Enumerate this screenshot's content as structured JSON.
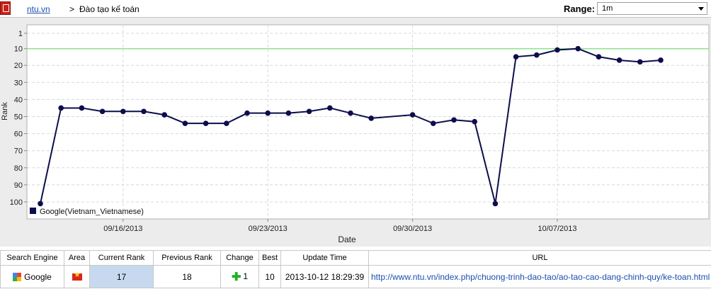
{
  "toolbar": {
    "domain": "ntu.vn",
    "separator": ">",
    "keyword": "Đào tạo kế toán",
    "range_label": "Range:",
    "range_value": "1m"
  },
  "chart_data": {
    "type": "line",
    "xlabel": "Date",
    "ylabel": "Rank",
    "ylim": [
      1,
      104
    ],
    "y_inverted": true,
    "yticks": [
      1,
      10,
      20,
      30,
      40,
      50,
      60,
      70,
      80,
      90,
      100
    ],
    "xticks": [
      "09/16/2013",
      "09/23/2013",
      "09/30/2013",
      "10/07/2013"
    ],
    "x_tick_day_index": [
      4,
      11,
      18,
      25
    ],
    "grid": true,
    "legend_position": "bottom-left",
    "reference_line_rank": 10,
    "colors": {
      "series": "#0d0d4d",
      "reference": "#90e090",
      "background": "#ffffff",
      "grid": "#d8d8d8"
    },
    "series": [
      {
        "name": "Google(Vietnam_Vietnamese)",
        "x": [
          0,
          1,
          2,
          3,
          4,
          5,
          6,
          7,
          8,
          9,
          10,
          11,
          12,
          13,
          14,
          15,
          16,
          18,
          19,
          20,
          21,
          22,
          23,
          24,
          25,
          26,
          27,
          28,
          29,
          30
        ],
        "values": [
          101,
          45,
          45,
          47,
          47,
          47,
          49,
          54,
          54,
          54,
          48,
          48,
          48,
          47,
          45,
          48,
          51,
          49,
          54,
          52,
          53,
          101,
          15,
          14,
          11,
          10,
          15,
          17,
          18,
          17
        ]
      }
    ]
  },
  "table": {
    "headers": [
      "Search Engine",
      "Area",
      "Current Rank",
      "Previous Rank",
      "Change",
      "Best",
      "Update Time",
      "URL"
    ],
    "row": {
      "engine": "Google",
      "current_rank": "17",
      "previous_rank": "18",
      "change": "1",
      "best": "10",
      "update_time": "2013-10-12 18:29:39",
      "url": "http://www.ntu.vn/index.php/chuong-trinh-dao-tao/ao-tao-cao-dang-chinh-quy/ke-toan.html"
    }
  }
}
